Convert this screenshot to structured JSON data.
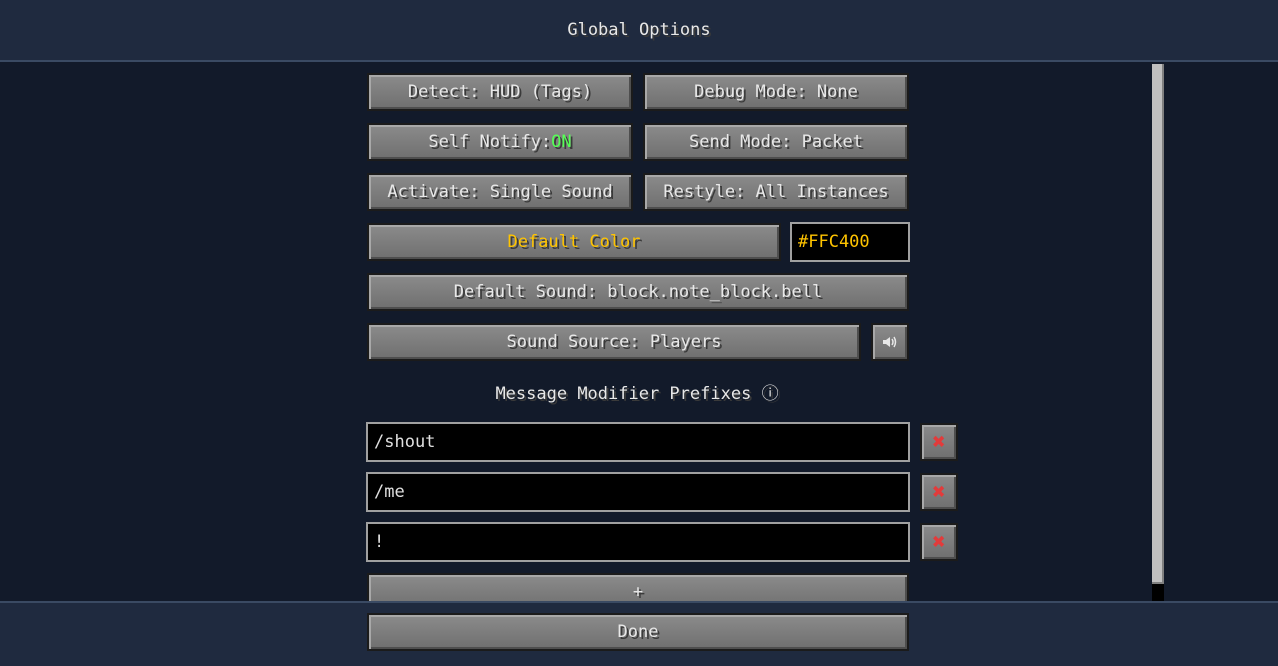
{
  "window": {
    "title": "Global Options"
  },
  "options": {
    "detect": "Detect: HUD (Tags)",
    "debug_mode": "Debug Mode: None",
    "self_notify_label": "Self Notify: ",
    "self_notify_value": "ON",
    "send_mode": "Send Mode: Packet",
    "activate": "Activate: Single Sound",
    "restyle": "Restyle: All Instances",
    "default_color_label": "Default Color",
    "default_color_value": "#FFC400",
    "default_sound": "Default Sound: block.note_block.bell",
    "sound_source": "Sound Source: Players",
    "volume_icon": "speaker-icon"
  },
  "colors": {
    "accent_yellow": "#FFC400",
    "on_green": "#55FF55",
    "remove_red": "#E23B3B"
  },
  "prefixes": {
    "heading": "Message Modifier Prefixes",
    "info_icon": "ⓘ",
    "items": [
      "/shout",
      "/me",
      "!"
    ],
    "remove_icon": "✖",
    "add_label": "+"
  },
  "footer": {
    "done_label": "Done"
  }
}
